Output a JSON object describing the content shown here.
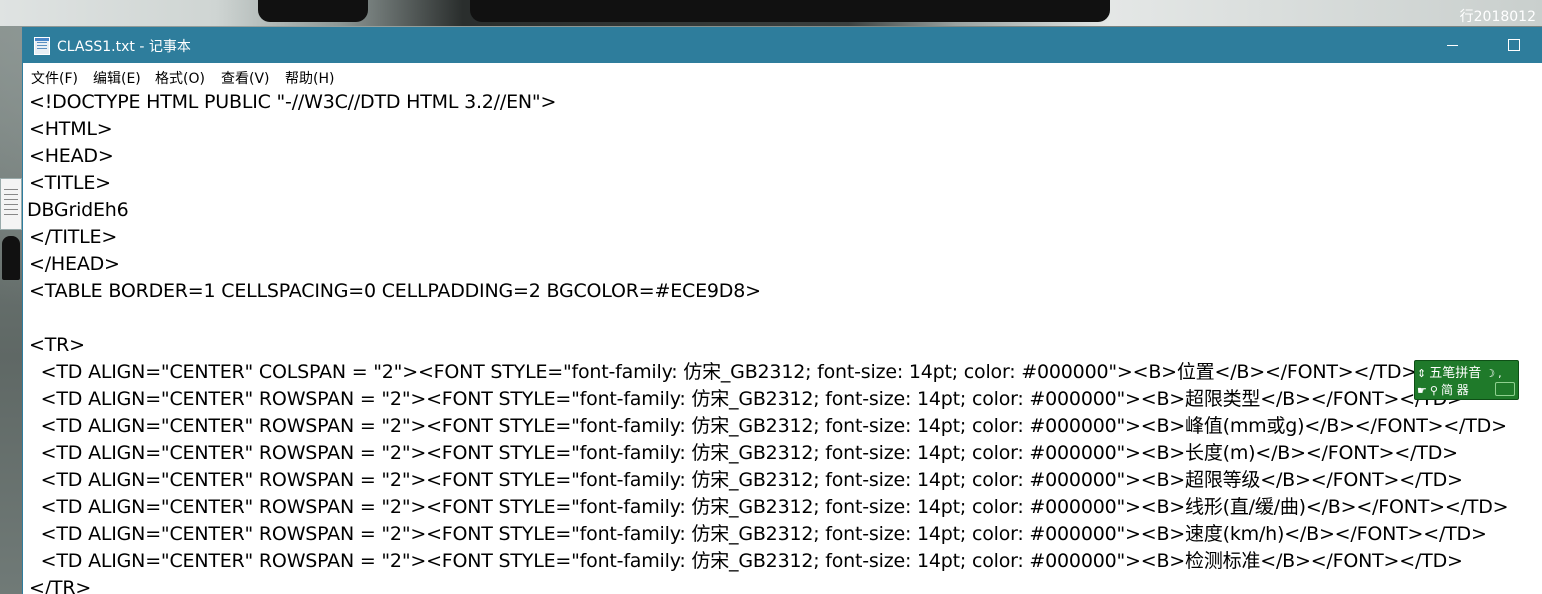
{
  "window": {
    "title": "CLASS1.txt - 记事本"
  },
  "menu": [
    {
      "label": "文件(F)"
    },
    {
      "label": "编辑(E)"
    },
    {
      "label": "格式(O)"
    },
    {
      "label": "查看(V)"
    },
    {
      "label": "帮助(H)"
    }
  ],
  "desktop": {
    "corner_text": "行2018012"
  },
  "lines": [
    "<!DOCTYPE HTML PUBLIC \"-//W3C//DTD HTML 3.2//EN\">",
    "<HTML>",
    "<HEAD>",
    "<TITLE>",
    "DBGridEh6",
    "</TITLE>",
    "</HEAD>",
    "<TABLE BORDER=1 CELLSPACING=0 CELLPADDING=2 BGCOLOR=#ECE9D8>",
    "",
    "<TR>",
    "  <TD ALIGN=\"CENTER\" COLSPAN = \"2\"><FONT STYLE=\"font-family: 仿宋_GB2312; font-size: 14pt; color: #000000\"><B>位置</B></FONT></TD>",
    "  <TD ALIGN=\"CENTER\" ROWSPAN = \"2\"><FONT STYLE=\"font-family: 仿宋_GB2312; font-size: 14pt; color: #000000\"><B>超限类型</B></FONT></TD>",
    "  <TD ALIGN=\"CENTER\" ROWSPAN = \"2\"><FONT STYLE=\"font-family: 仿宋_GB2312; font-size: 14pt; color: #000000\"><B>峰值(mm或g)</B></FONT></TD>",
    "  <TD ALIGN=\"CENTER\" ROWSPAN = \"2\"><FONT STYLE=\"font-family: 仿宋_GB2312; font-size: 14pt; color: #000000\"><B>长度(m)</B></FONT></TD>",
    "  <TD ALIGN=\"CENTER\" ROWSPAN = \"2\"><FONT STYLE=\"font-family: 仿宋_GB2312; font-size: 14pt; color: #000000\"><B>超限等级</B></FONT></TD>",
    "  <TD ALIGN=\"CENTER\" ROWSPAN = \"2\"><FONT STYLE=\"font-family: 仿宋_GB2312; font-size: 14pt; color: #000000\"><B>线形(直/缓/曲)</B></FONT></TD>",
    "  <TD ALIGN=\"CENTER\" ROWSPAN = \"2\"><FONT STYLE=\"font-family: 仿宋_GB2312; font-size: 14pt; color: #000000\"><B>速度(km/h)</B></FONT></TD>",
    "  <TD ALIGN=\"CENTER\" ROWSPAN = \"2\"><FONT STYLE=\"font-family: 仿宋_GB2312; font-size: 14pt; color: #000000\"><B>检测标准</B></FONT></TD>",
    "</TR>"
  ],
  "ime": {
    "label": "五笔拼音",
    "mode": "简 器",
    "accent": "#1f7a2a"
  },
  "icons": {
    "app": "notepad-icon",
    "minimize": "minimize-icon",
    "maximize": "maximize-icon"
  }
}
